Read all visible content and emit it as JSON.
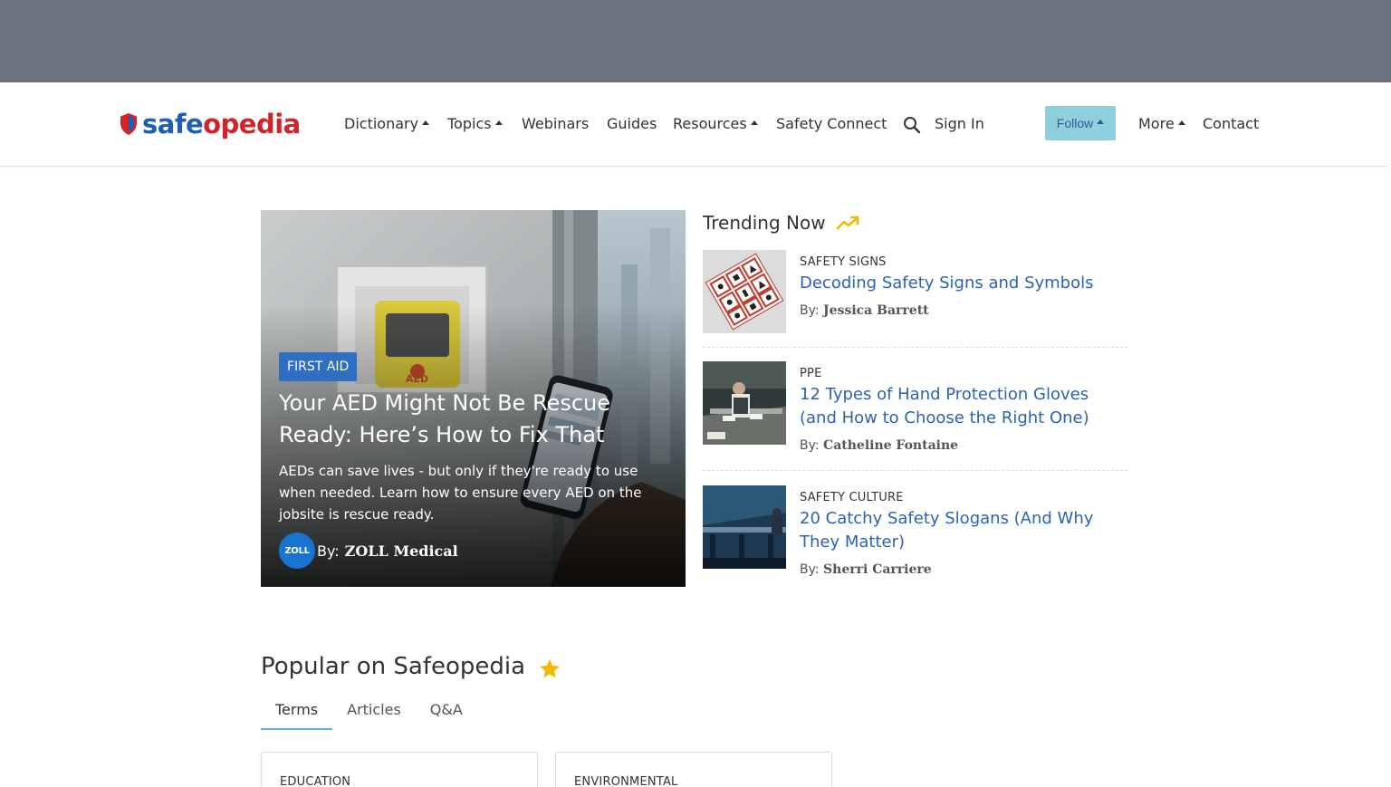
{
  "brand": {
    "name_part1": "safe",
    "name_part2": "opedia"
  },
  "nav": {
    "dictionary": "Dictionary",
    "topics": "Topics",
    "webinars": "Webinars",
    "guides": "Guides",
    "resources": "Resources",
    "safety_connect": "Safety Connect",
    "sign_in": "Sign In",
    "follow": "Follow",
    "more": "More",
    "contact": "Contact"
  },
  "hero": {
    "category": "FIRST AID",
    "title": "Your AED Might Not Be Rescue Ready: Here’s How to Fix That",
    "description": "AEDs can save lives - but only if they're ready to use when needed. Learn how to ensure every AED on the jobsite is rescue ready.",
    "by_label": "By:",
    "author": "ZOLL Medical",
    "author_badge": "ZOLL"
  },
  "trending": {
    "heading": "Trending Now",
    "items": [
      {
        "category": "SAFETY SIGNS",
        "title": "Decoding Safety Signs and Symbols",
        "by_label": "By:",
        "author": "Jessica Barrett"
      },
      {
        "category": "PPE",
        "title": "12 Types of Hand Protection Gloves (and How to Choose the Right One)",
        "by_label": "By:",
        "author": "Catheline Fontaine"
      },
      {
        "category": "SAFETY CULTURE",
        "title": "20 Catchy Safety Slogans (And Why They Matter)",
        "by_label": "By:",
        "author": "Sherri Carriere"
      }
    ]
  },
  "popular": {
    "heading": "Popular on Safeopedia",
    "tabs": [
      "Terms",
      "Articles",
      "Q&A"
    ],
    "active_tab": "Terms",
    "cards": [
      {
        "category": "EDUCATION"
      },
      {
        "category": "ENVIRONMENTAL"
      }
    ]
  },
  "colors": {
    "link": "#2b63b2",
    "follow_bg": "#8ecfdd",
    "badge_bg": "#2e6fc2",
    "accent_tab": "#5cb8c7",
    "star": "#f5b800"
  }
}
